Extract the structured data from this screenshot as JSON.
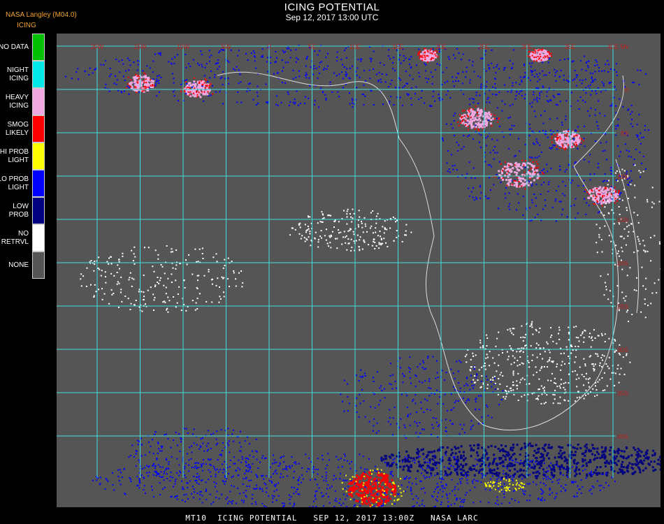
{
  "header": {
    "credit": "NASA Langley (M04.0)",
    "legend_title": "ICING",
    "title": "ICING POTENTIAL",
    "subtitle": "Sep 12, 2017 13:00 UTC"
  },
  "legend": {
    "items": [
      {
        "label": "NO DATA",
        "color": "#00c000"
      },
      {
        "label": "NIGHT\nICING",
        "color": "#00e8e8"
      },
      {
        "label": "HEAVY\nICING",
        "color": "#f0a8e0"
      },
      {
        "label": "SMOG\nLIKELY",
        "color": "#ff0000"
      },
      {
        "label": "HI PROB\nLIGHT",
        "color": "#ffff00"
      },
      {
        "label": "LO PROB\nLIGHT",
        "color": "#0000ff"
      },
      {
        "label": "LOW\nPROB",
        "color": "#000080"
      },
      {
        "label": "NO\nRETRVL",
        "color": "#ffffff"
      },
      {
        "label": "NONE",
        "color": "#555555"
      }
    ]
  },
  "map": {
    "background_color": "#555555",
    "grid_color": "#40e0e0",
    "coast_color": "#dddddd",
    "lon_labels": [
      "20W",
      "15W",
      "10W",
      "5W",
      "0",
      "5E",
      "10E",
      "15E",
      "20E",
      "25E",
      "30E",
      "35E",
      "40E"
    ],
    "lat_labels": [
      "5N",
      "0",
      "5S",
      "10S",
      "15S",
      "20S",
      "25S",
      "30S",
      "35S",
      "40S"
    ]
  },
  "footer": {
    "text": "MT10  ICING POTENTIAL   SEP 12, 2017 13:00Z   NASA LARC"
  }
}
